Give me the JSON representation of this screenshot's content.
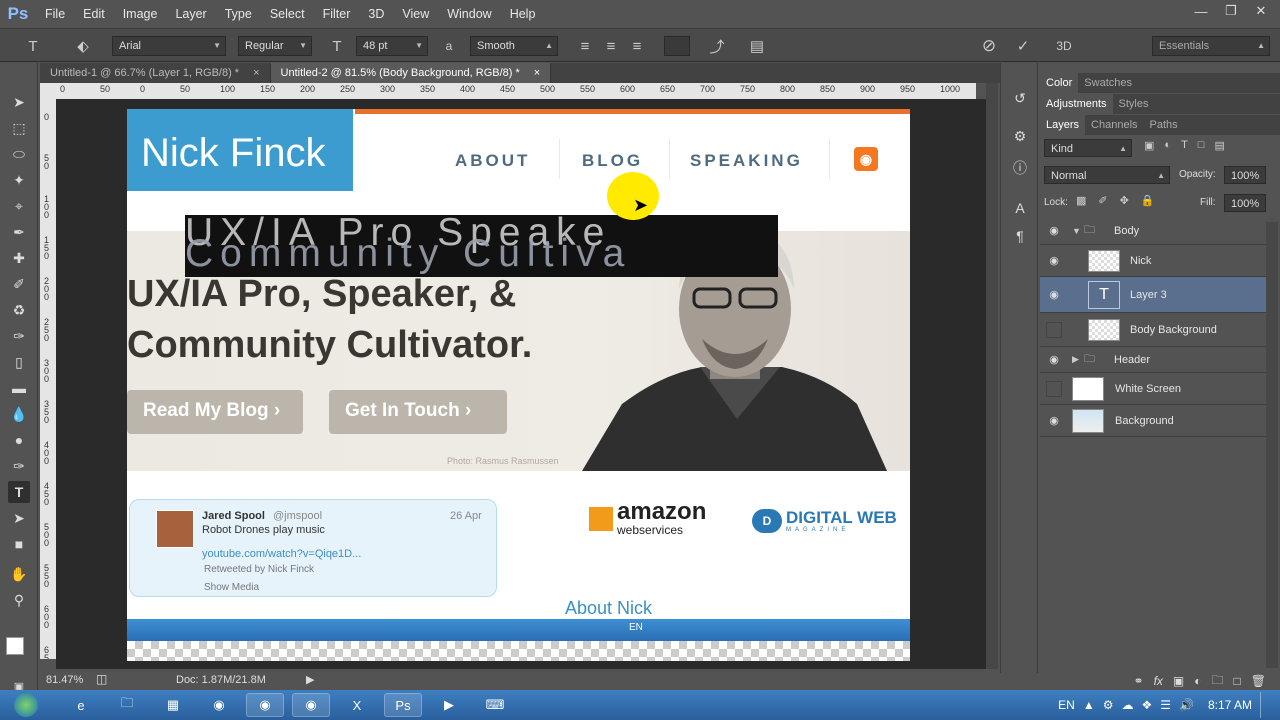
{
  "app": {
    "logo": "Ps"
  },
  "menu": [
    "File",
    "Edit",
    "Image",
    "Layer",
    "Type",
    "Select",
    "Filter",
    "3D",
    "View",
    "Window",
    "Help"
  ],
  "options_bar": {
    "font_family": "Arial",
    "font_style": "Regular",
    "font_size": "48 pt",
    "aa_label": "a",
    "antialias": "Smooth",
    "three_d": "3D",
    "workspace": "Essentials"
  },
  "tabs": [
    {
      "label": "Untitled-1 @ 66.7% (Layer 1, RGB/8) *",
      "close": "×"
    },
    {
      "label": "Untitled-2 @ 81.5% (Body Background, RGB/8) *",
      "close": "×"
    }
  ],
  "ruler": {
    "h_ticks": [
      "0",
      "50",
      "0",
      "50",
      "100",
      "150",
      "200",
      "250",
      "300",
      "350",
      "400",
      "450",
      "500",
      "550",
      "600",
      "650",
      "700",
      "750",
      "800",
      "850",
      "900",
      "950",
      "1000"
    ],
    "v_ticks": [
      "0",
      "5 0",
      "1 0 0",
      "1 5 0",
      "2 0 0",
      "2 5 0",
      "3 0 0",
      "3 5 0",
      "4 0 0",
      "4 5 0",
      "5 0 0",
      "5 5 0",
      "6 0 0",
      "6 5 0"
    ]
  },
  "document": {
    "logo_text": "Nick Finck",
    "nav": [
      "ABOUT",
      "BLOG",
      "SPEAKING"
    ],
    "rss": "◉",
    "text_layer_line1": "UX/IA Pro Speake",
    "text_layer_line2": "Community Cultiva",
    "hero_line1": "UX/IA Pro,  Speaker, &",
    "hero_line2": "Community Cultivator.",
    "btn_blog": "Read My Blog ›",
    "btn_touch": "Get In Touch ›",
    "photo_credit": "Photo: Rasmus Rasmussen",
    "tweet": {
      "name": "Jared Spool",
      "handle": "@jmspool",
      "date": "26 Apr",
      "text": "Robot Drones play music",
      "link": "youtube.com/watch?v=Qiqe1D...",
      "retweet": "Retweeted by Nick Finck",
      "media": "Show Media"
    },
    "amazon_1": "amazon",
    "amazon_2": "webservices",
    "digital_web": "DIGITAL WEB",
    "digital_web_sub": "MAGAZINE",
    "about_heading": "About Nick",
    "taskbar_lang": "EN"
  },
  "status": {
    "zoom": "81.47%",
    "doc_size": "Doc: 1.87M/21.8M"
  },
  "panels": {
    "top_tabs": [
      "Color",
      "Swatches"
    ],
    "adj_tabs": [
      "Adjustments",
      "Styles"
    ],
    "layer_tabs": [
      "Layers",
      "Channels",
      "Paths"
    ],
    "kind": "Kind",
    "blend": "Normal",
    "opacity_label": "Opacity:",
    "opacity": "100%",
    "lock_label": "Lock:",
    "fill_label": "Fill:",
    "fill": "100%"
  },
  "layers": [
    {
      "name": "Body",
      "type": "group-open"
    },
    {
      "name": "Nick",
      "type": "image"
    },
    {
      "name": "Layer 3",
      "type": "text"
    },
    {
      "name": "Body Background",
      "type": "image"
    },
    {
      "name": "Header",
      "type": "group-closed"
    },
    {
      "name": "White Screen",
      "type": "image"
    },
    {
      "name": "Background",
      "type": "image"
    }
  ],
  "taskbar": {
    "lang": "EN",
    "time": "8:17 AM"
  },
  "colors": {
    "accent": "#3d9ccf",
    "orange": "#e8722c",
    "layer_selected": "#5a6e8e"
  }
}
